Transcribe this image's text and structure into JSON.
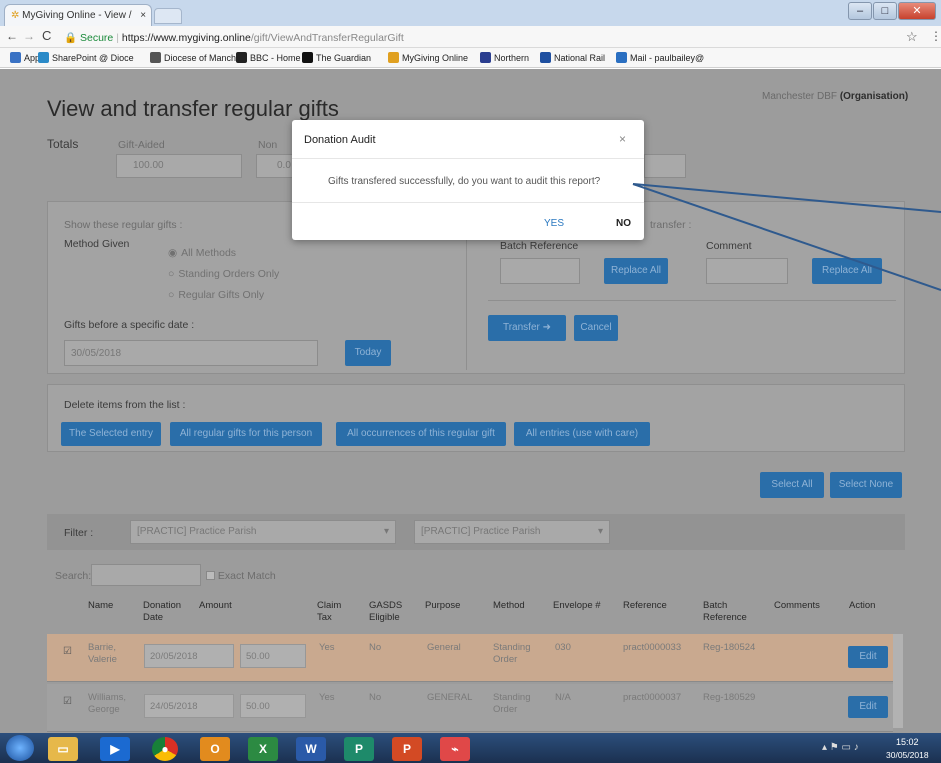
{
  "browser": {
    "tab_title": "MyGiving Online - View /",
    "tab_close": "×",
    "secure_label": "Secure",
    "url_host": "https://www.mygiving.online",
    "url_path": "/gift/ViewAndTransferRegularGift",
    "star": "☆",
    "bookmarks": [
      {
        "label": "Apps",
        "color": "#3a72c4"
      },
      {
        "label": "SharePoint @ Dioce",
        "color": "#2a8ac8"
      },
      {
        "label": "Diocese of Manches",
        "color": "#555555"
      },
      {
        "label": "BBC - Home",
        "color": "#222222"
      },
      {
        "label": "The Guardian",
        "color": "#111111"
      },
      {
        "label": "MyGiving Online",
        "color": "#e0a020"
      },
      {
        "label": "Northern",
        "color": "#2a3d8f"
      },
      {
        "label": "National Rail",
        "color": "#1e4fa0"
      },
      {
        "label": "Mail - paulbailey@",
        "color": "#2a6fc1"
      }
    ]
  },
  "page": {
    "org": "Manchester DBF",
    "org_type": "(Organisation)",
    "title": "View and transfer regular gifts",
    "totals_label": "Totals",
    "gift_aided_label": "Gift-Aided",
    "gift_aided_value": "100.00",
    "non_label": "Non",
    "non_value": "0.0",
    "show_label": "Show these regular gifts :",
    "method_label": "Method Given",
    "methods": [
      "All Methods",
      "Standing Orders Only",
      "Regular Gifts Only"
    ],
    "before_date_label": "Gifts before a specific date :",
    "date_value": "30/05/2018",
    "today_btn": "Today",
    "transfer_hint": "transfer :",
    "batch_ref_label": "Batch Reference",
    "comment_label": "Comment",
    "replace_all": "Replace All",
    "transfer_btn": "Transfer",
    "cancel_btn": "Cancel",
    "delete_label": "Delete items from the list :",
    "delete_buttons": [
      "The Selected entry",
      "All regular gifts for this person",
      "All occurrences of this regular gift",
      "All entries (use with care)"
    ],
    "select_all": "Select All",
    "select_none": "Select None",
    "filter_label": "Filter :",
    "filter_1": "[PRACTIC] Practice Parish",
    "filter_2": "[PRACTIC] Practice Parish",
    "search_label": "Search:",
    "exact_match": "Exact Match",
    "columns": [
      "Name",
      "Donation Date",
      "Amount",
      "Claim Tax",
      "GASDS Eligible",
      "Purpose",
      "Method",
      "Envelope #",
      "Reference",
      "Batch Reference",
      "Comments",
      "Action"
    ],
    "rows": [
      {
        "name": "Barrie, Valerie",
        "date": "20/05/2018",
        "amount": "50.00",
        "claim": "Yes",
        "gasds": "No",
        "purpose": "General",
        "method": "Standing Order",
        "envelope": "030",
        "reference": "pract0000033",
        "batch": "Reg-180524",
        "action": "Edit"
      },
      {
        "name": "Williams, George",
        "date": "24/05/2018",
        "amount": "50.00",
        "claim": "Yes",
        "gasds": "No",
        "purpose": "GENERAL",
        "method": "Standing Order",
        "envelope": "N/A",
        "reference": "pract0000037",
        "batch": "Reg-180529",
        "action": "Edit"
      }
    ]
  },
  "modal": {
    "title": "Donation Audit",
    "close": "×",
    "message": "Gifts transfered successfully, do you want to audit this report?",
    "yes": "YES",
    "no": "NO"
  },
  "taskbar": {
    "time": "15:02",
    "date": "30/05/2018"
  },
  "colors": {
    "primary_button": "#2a6ea9",
    "selected_row": "#c9a98f",
    "annotation_arrow": "#2f5a8e"
  }
}
